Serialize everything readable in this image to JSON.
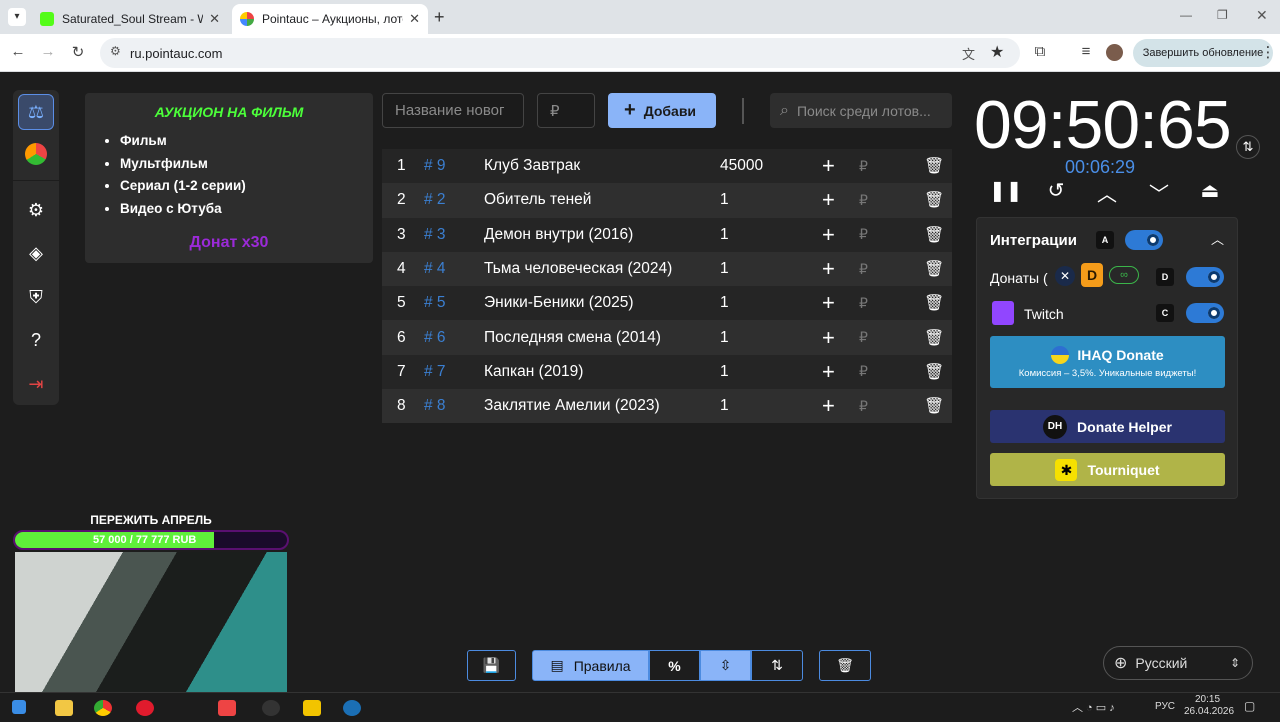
{
  "tabs": [
    {
      "title": "Saturated_Soul Stream - Watch",
      "icon": "kick-icon"
    },
    {
      "title": "Pointauc – Аукционы, лотереи",
      "icon": "pointauc-icon"
    }
  ],
  "url": "ru.pointauc.com",
  "update_label": "Завершить обновление",
  "note": {
    "title": "АУКЦИОН НА ФИЛЬМ",
    "items": [
      "Фильм",
      "Мультфильм",
      "Сериал (1-2 серии)",
      "Видео с Ютуба"
    ],
    "donate": "Донат x30"
  },
  "new_lot_placeholder": "Название новог",
  "amount_placeholder": "₽",
  "add_label": "Добави",
  "search_placeholder": "Поиск среди лотов...",
  "lots": [
    {
      "n": "1",
      "id": "# 9",
      "name": "Клуб Завтрак",
      "amount": "45000"
    },
    {
      "n": "2",
      "id": "# 2",
      "name": "Обитель теней",
      "amount": "1"
    },
    {
      "n": "3",
      "id": "# 3",
      "name": "Демон внутри (2016)",
      "amount": "1"
    },
    {
      "n": "4",
      "id": "# 4",
      "name": "Тьма человеческая (2024)",
      "amount": "1"
    },
    {
      "n": "5",
      "id": "# 5",
      "name": "Эники-Беники (2025)",
      "amount": "1"
    },
    {
      "n": "6",
      "id": "# 6",
      "name": "Последняя смена (2014)",
      "amount": "1"
    },
    {
      "n": "7",
      "id": "# 7",
      "name": "Капкан (2019)",
      "amount": "1"
    },
    {
      "n": "8",
      "id": "# 8",
      "name": "Заклятие Амелии (2023)",
      "amount": "1"
    }
  ],
  "currency": "₽",
  "timer": "09:50:65",
  "timer_sub": "00:06:29",
  "integrations": {
    "title": "Интеграции",
    "key_a": "A",
    "donations_label": "Донаты (",
    "key_d": "D",
    "twitch_label": "Twitch",
    "key_c": "C",
    "ihaq_title": "IHAQ Donate",
    "ihaq_sub": "Комиссия – 3,5%. Уникальные виджеты!",
    "dh_label": "Donate Helper",
    "tq_label": "Tourniquet"
  },
  "bottom": {
    "rules_label": "Правила"
  },
  "language": "Русский",
  "overlay": {
    "title": "ПЕРЕЖИТЬ АПРЕЛЬ",
    "progress_text": "57 000 / 77 777 RUB",
    "progress": 0.733
  },
  "taskbar": {
    "lang": "РУС",
    "time": "20:15",
    "date": "26.04.2026"
  }
}
